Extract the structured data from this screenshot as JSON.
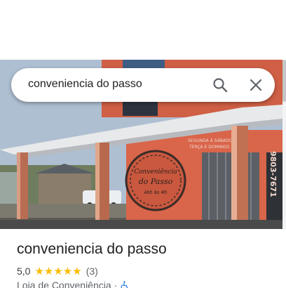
{
  "search": {
    "query": "conveniencia do passo",
    "search_icon": "search-icon",
    "clear_icon": "close-icon"
  },
  "photo": {
    "description_icon": "storefront-photo",
    "sign_lines": [
      "Conveniência",
      "do Passo",
      "Até às 4h"
    ],
    "banner_text": [
      "SEGUNDA À SÁBADO",
      "TERÇA E DOMINGO"
    ],
    "phone_fragment": "9803-7671"
  },
  "place": {
    "name": "conveniencia do passo",
    "rating": "5,0",
    "stars": "★★★★★",
    "reviews": "(3)",
    "category": "Loja de Conveniência",
    "separator": "·",
    "accessibility_icon": "wheelchair-icon"
  },
  "colors": {
    "star": "#fbbc04",
    "wall": "#d9654a",
    "accent_blue": "#1a73e8"
  }
}
